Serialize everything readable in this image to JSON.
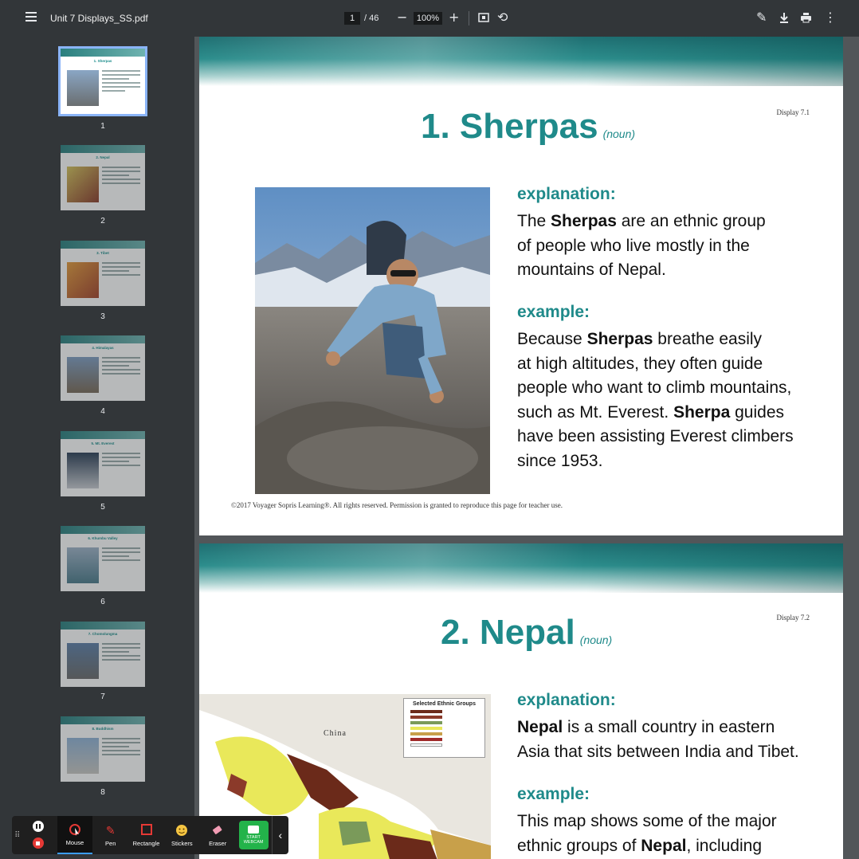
{
  "toolbar": {
    "title": "Unit 7 Displays_SS.pdf",
    "page_current": "1",
    "page_total": "/ 46",
    "zoom": "100%",
    "zoom_out_icon": "minus-icon",
    "zoom_in_icon": "plus-icon"
  },
  "thumbnails": [
    {
      "num": "1",
      "title": "1. Sherpas",
      "active": true
    },
    {
      "num": "2",
      "title": "2. Nepal"
    },
    {
      "num": "3",
      "title": "3. Tibet"
    },
    {
      "num": "4",
      "title": "4. Himalayas"
    },
    {
      "num": "5",
      "title": "5. Mt. Everest"
    },
    {
      "num": "6",
      "title": "6. Khumbu Valley"
    },
    {
      "num": "7",
      "title": "7. Chomolungma"
    },
    {
      "num": "8",
      "title": "8. Buddhism"
    }
  ],
  "page1": {
    "display_no": "Display 7.1",
    "word": "1. Sherpas",
    "pos": "(noun)",
    "explanation_label": "explanation:",
    "example_label": "example:",
    "copyright": "©2017 Voyager Sopris Learning®. All rights reserved. Permission is granted to reproduce this page for teacher use."
  },
  "page2": {
    "display_no": "Display 7.2",
    "word": "2. Nepal",
    "pos": "(noun)",
    "explanation_label": "explanation:",
    "example_label": "example:",
    "map_legend_title": "Selected Ethnic Groups",
    "map_country_label": "China"
  },
  "recorder": {
    "tools": [
      "Mouse",
      "Pen",
      "Rectangle",
      "Stickers",
      "Eraser"
    ],
    "webcam": "START WEBCAM"
  }
}
